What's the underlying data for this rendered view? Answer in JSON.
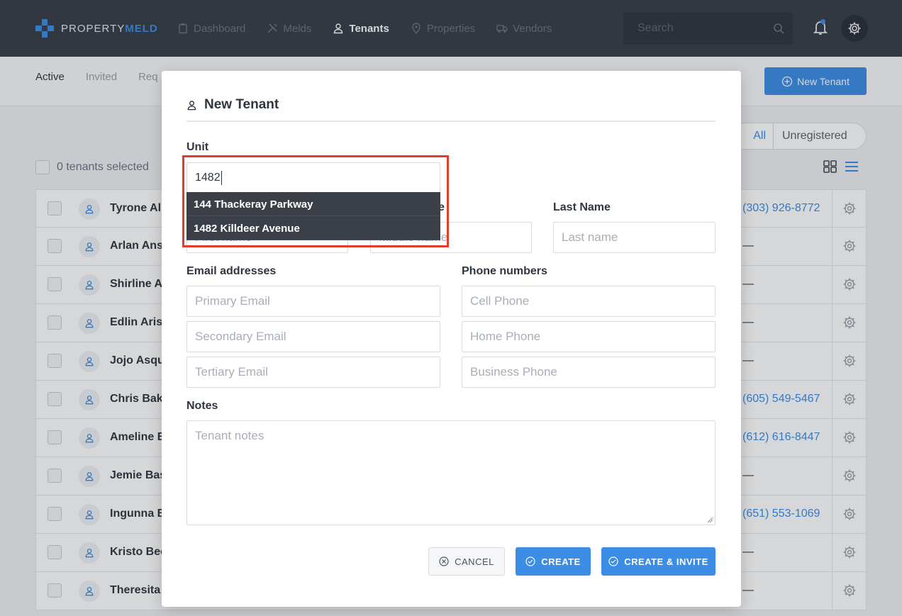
{
  "brand": {
    "name_plain": "PROPERTY",
    "name_bold": "MELD",
    "accent": "#3b8de6"
  },
  "nav": [
    {
      "label": "Dashboard",
      "icon": "clipboard-icon"
    },
    {
      "label": "Melds",
      "icon": "tools-icon"
    },
    {
      "label": "Tenants",
      "icon": "user-icon",
      "active": true
    },
    {
      "label": "Properties",
      "icon": "map-pin-icon"
    },
    {
      "label": "Vendors",
      "icon": "truck-icon"
    }
  ],
  "search": {
    "placeholder": "Search"
  },
  "subtabs": [
    "Active",
    "Invited",
    "Req"
  ],
  "new_tenant_button": "New Tenant",
  "filters": {
    "all": "All",
    "unregistered": "Unregistered"
  },
  "selection": {
    "label": "0 tenants selected"
  },
  "tenants": [
    {
      "name": "Tyrone Al",
      "phone": "(303) 926-8772"
    },
    {
      "name": "Arlan Ans",
      "phone": "—"
    },
    {
      "name": "Shirline A",
      "phone": "—"
    },
    {
      "name": "Edlin Arist",
      "phone": "—"
    },
    {
      "name": "Jojo Asque",
      "phone": "—"
    },
    {
      "name": "Chris Bake",
      "phone": "(605) 549-5467"
    },
    {
      "name": "Ameline B",
      "phone": "(612) 616-8447"
    },
    {
      "name": "Jemie Bas",
      "phone": "—"
    },
    {
      "name": "Ingunna B",
      "phone": "(651) 553-1069"
    },
    {
      "name": "Kristo Bec",
      "phone": "—"
    },
    {
      "name": "Theresita",
      "phone": "—"
    }
  ],
  "modal": {
    "title": "New Tenant",
    "unit_label": "Unit",
    "unit_value": "1482",
    "unit_suggestions": [
      "144 Thackeray Parkway",
      "1482 Killdeer Avenue"
    ],
    "first_name_placeholder": "First name",
    "middle_name_label_tail": "e",
    "middle_name_placeholder": "Middle name",
    "last_name_label": "Last Name",
    "last_name_placeholder": "Last name",
    "email_label": "Email addresses",
    "email_placeholders": [
      "Primary Email",
      "Secondary Email",
      "Tertiary Email"
    ],
    "phone_label": "Phone numbers",
    "phone_placeholders": [
      "Cell Phone",
      "Home Phone",
      "Business Phone"
    ],
    "notes_label": "Notes",
    "notes_placeholder": "Tenant notes",
    "buttons": {
      "cancel": "CANCEL",
      "create": "CREATE",
      "create_invite": "CREATE & INVITE"
    }
  }
}
